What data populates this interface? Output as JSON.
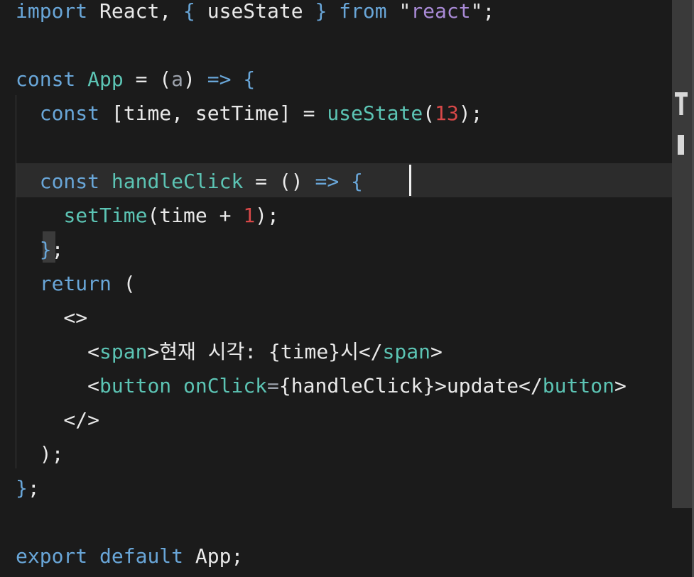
{
  "editor": {
    "lines": [
      [
        [
          "k",
          "import"
        ],
        [
          "p",
          " React, "
        ],
        [
          "b",
          "{"
        ],
        [
          "p",
          " useState "
        ],
        [
          "b",
          "}"
        ],
        [
          "p",
          " "
        ],
        [
          "k",
          "from"
        ],
        [
          "p",
          " \""
        ],
        [
          "s",
          "react"
        ],
        [
          "p",
          "\";"
        ]
      ],
      [],
      [
        [
          "k",
          "const"
        ],
        [
          "p",
          " "
        ],
        [
          "f",
          "App"
        ],
        [
          "p",
          " = ("
        ],
        [
          "m",
          "a"
        ],
        [
          "p",
          ") "
        ],
        [
          "k",
          "=>"
        ],
        [
          "p",
          " "
        ],
        [
          "b",
          "{"
        ]
      ],
      [
        [
          "p",
          "  "
        ],
        [
          "k",
          "const"
        ],
        [
          "p",
          " [time, setTime] = "
        ],
        [
          "f",
          "useState"
        ],
        [
          "p",
          "("
        ],
        [
          "n",
          "13"
        ],
        [
          "p",
          ");"
        ]
      ],
      [],
      [
        [
          "p",
          "  "
        ],
        [
          "k",
          "const"
        ],
        [
          "p",
          " "
        ],
        [
          "f",
          "handleClick"
        ],
        [
          "p",
          " = () "
        ],
        [
          "k",
          "=>"
        ],
        [
          "p",
          " "
        ],
        [
          "b",
          "{"
        ]
      ],
      [
        [
          "p",
          "    "
        ],
        [
          "f",
          "setTime"
        ],
        [
          "p",
          "(time + "
        ],
        [
          "n",
          "1"
        ],
        [
          "p",
          ");"
        ]
      ],
      [
        [
          "p",
          "  "
        ],
        [
          "b",
          "}"
        ],
        [
          "p",
          ";"
        ]
      ],
      [
        [
          "p",
          "  "
        ],
        [
          "k",
          "return"
        ],
        [
          "p",
          " ("
        ]
      ],
      [
        [
          "p",
          "    <>"
        ]
      ],
      [
        [
          "p",
          "      <"
        ],
        [
          "f",
          "span"
        ],
        [
          "p",
          ">현재 시각: {time}시</"
        ],
        [
          "f",
          "span"
        ],
        [
          "p",
          ">"
        ]
      ],
      [
        [
          "p",
          "      <"
        ],
        [
          "f",
          "button"
        ],
        [
          "p",
          " "
        ],
        [
          "f",
          "onClick"
        ],
        [
          "m",
          "="
        ],
        [
          "p",
          "{handleClick}>update</"
        ],
        [
          "f",
          "button"
        ],
        [
          "p",
          ">"
        ]
      ],
      [
        [
          "p",
          "    </>"
        ]
      ],
      [
        [
          "p",
          "  );"
        ]
      ],
      [
        [
          "b",
          "}"
        ],
        [
          "p",
          ";"
        ]
      ],
      [],
      [
        [
          "k",
          "export"
        ],
        [
          "p",
          " "
        ],
        [
          "k",
          "default"
        ],
        [
          "p",
          " App;"
        ]
      ]
    ]
  },
  "scrollbar": {
    "track_color": "#3a3a3a"
  },
  "colors": {
    "background": "#1b1b1b",
    "keyword": "#69a6d8",
    "function": "#5cc4b4",
    "number": "#d74848",
    "string": "#a98ad6",
    "plain": "#e9e9e9"
  }
}
